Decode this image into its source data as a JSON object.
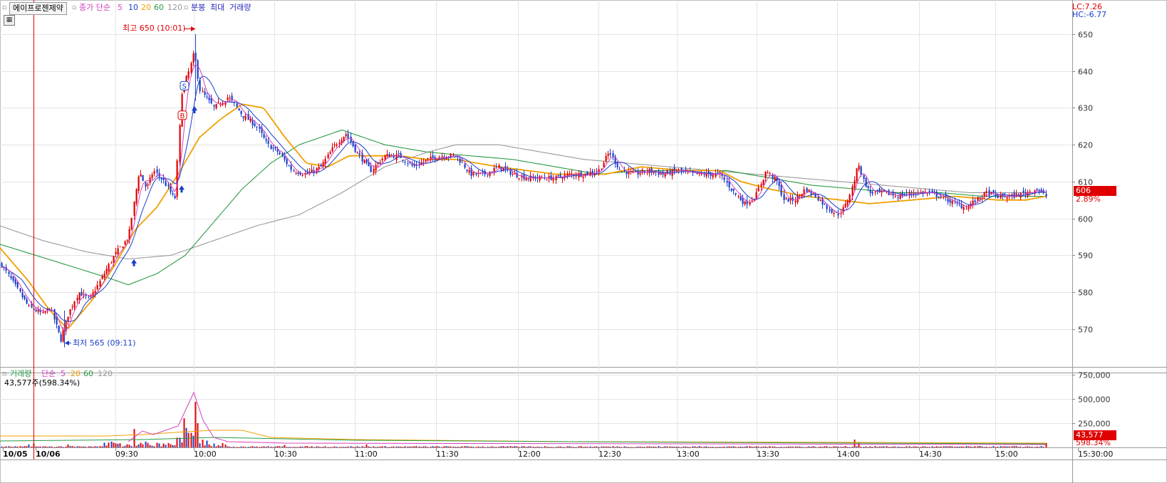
{
  "toolbar": {
    "stock_name": "에이프로젠제약",
    "ma_label": "종가 단순",
    "ma_periods": [
      "5",
      "10",
      "20",
      "60",
      "120"
    ],
    "ma_colors": [
      "#d43fbf",
      "#1a3fc8",
      "#f2a000",
      "#2a9a45",
      "#9a9a9a"
    ],
    "extra": [
      "분봉",
      "최대",
      "거래량"
    ]
  },
  "top_right": {
    "lc": "LC:7.26",
    "hc": "HC:-6.77"
  },
  "price_badge": {
    "price": "606",
    "pct": "2.89%"
  },
  "volume_panel": {
    "title": "거래량",
    "ma_label": "단순",
    "ma_periods": [
      "5",
      "20",
      "60",
      "120"
    ],
    "info": "43,577주(598.34%)",
    "badge_value": "43,577",
    "badge_pct": "598.34%"
  },
  "annotations": {
    "high": "최고 650 (10:01)",
    "low": "최저 565 (09:11)"
  },
  "chart_data": [
    {
      "type": "candlestick",
      "title": "",
      "y_ticks": [
        "650",
        "640",
        "630",
        "620",
        "610",
        "600",
        "590",
        "580",
        "570"
      ],
      "ylim": [
        560.5,
        652.5
      ],
      "x_ticks": [
        "10/05",
        "10/06",
        "09:30",
        "10:00",
        "10:30",
        "11:00",
        "11:30",
        "12:00",
        "12:30",
        "13:00",
        "13:30",
        "14:00",
        "14:30",
        "15:00",
        "15:30:00"
      ],
      "grid": true,
      "close_path": [
        [
          0,
          588
        ],
        [
          40,
          576
        ],
        [
          60,
          574
        ],
        [
          70,
          576
        ],
        [
          80,
          570
        ],
        [
          85,
          567
        ],
        [
          95,
          574
        ],
        [
          110,
          580
        ],
        [
          125,
          578
        ],
        [
          140,
          583
        ],
        [
          160,
          590
        ],
        [
          180,
          595
        ],
        [
          195,
          613
        ],
        [
          205,
          608
        ],
        [
          215,
          613
        ],
        [
          230,
          610
        ],
        [
          245,
          605
        ],
        [
          255,
          635
        ],
        [
          265,
          640
        ],
        [
          272,
          645
        ],
        [
          280,
          635
        ],
        [
          300,
          630
        ],
        [
          320,
          633
        ],
        [
          340,
          628
        ],
        [
          360,
          625
        ],
        [
          375,
          620
        ],
        [
          390,
          618
        ],
        [
          410,
          613
        ],
        [
          430,
          612
        ],
        [
          450,
          614
        ],
        [
          470,
          620
        ],
        [
          485,
          623
        ],
        [
          500,
          618
        ],
        [
          520,
          613
        ],
        [
          540,
          617
        ],
        [
          560,
          617
        ],
        [
          580,
          614
        ],
        [
          600,
          616
        ],
        [
          620,
          617
        ],
        [
          640,
          617
        ],
        [
          660,
          612
        ],
        [
          680,
          612
        ],
        [
          700,
          614
        ],
        [
          720,
          612
        ],
        [
          740,
          611
        ],
        [
          760,
          611
        ],
        [
          780,
          611
        ],
        [
          800,
          612
        ],
        [
          820,
          612
        ],
        [
          840,
          613
        ],
        [
          855,
          618
        ],
        [
          870,
          613
        ],
        [
          890,
          612
        ],
        [
          910,
          613
        ],
        [
          930,
          612
        ],
        [
          950,
          613
        ],
        [
          970,
          612
        ],
        [
          990,
          612
        ],
        [
          1010,
          612
        ],
        [
          1030,
          607
        ],
        [
          1045,
          604
        ],
        [
          1060,
          606
        ],
        [
          1075,
          613
        ],
        [
          1090,
          610
        ],
        [
          1100,
          605
        ],
        [
          1115,
          605
        ],
        [
          1130,
          608
        ],
        [
          1145,
          606
        ],
        [
          1160,
          603
        ],
        [
          1175,
          601
        ],
        [
          1185,
          603
        ],
        [
          1195,
          608
        ],
        [
          1205,
          615
        ],
        [
          1210,
          611
        ],
        [
          1220,
          607
        ],
        [
          1240,
          607
        ],
        [
          1260,
          606
        ],
        [
          1280,
          607
        ],
        [
          1300,
          607
        ],
        [
          1320,
          606
        ],
        [
          1340,
          604
        ],
        [
          1355,
          603
        ],
        [
          1370,
          605
        ],
        [
          1385,
          607
        ],
        [
          1400,
          606
        ],
        [
          1420,
          606
        ],
        [
          1440,
          607
        ],
        [
          1455,
          608
        ],
        [
          1468,
          606
        ]
      ],
      "moving_averages": {
        "ma20": [
          [
            0,
            592
          ],
          [
            40,
            583
          ],
          [
            70,
            575
          ],
          [
            95,
            570
          ],
          [
            130,
            578
          ],
          [
            160,
            587
          ],
          [
            190,
            597
          ],
          [
            220,
            603
          ],
          [
            250,
            612
          ],
          [
            280,
            622
          ],
          [
            310,
            627
          ],
          [
            340,
            631
          ],
          [
            370,
            630
          ],
          [
            400,
            622
          ],
          [
            430,
            615
          ],
          [
            460,
            614
          ],
          [
            490,
            617
          ],
          [
            520,
            617
          ],
          [
            560,
            617
          ],
          [
            600,
            616
          ],
          [
            640,
            616
          ],
          [
            700,
            614
          ],
          [
            780,
            612
          ],
          [
            850,
            612
          ],
          [
            900,
            614
          ],
          [
            960,
            613
          ],
          [
            1010,
            613
          ],
          [
            1040,
            610
          ],
          [
            1080,
            608
          ],
          [
            1130,
            606
          ],
          [
            1180,
            605
          ],
          [
            1220,
            604
          ],
          [
            1280,
            605
          ],
          [
            1340,
            606
          ],
          [
            1400,
            605
          ],
          [
            1440,
            605
          ],
          [
            1468,
            606
          ]
        ],
        "ma60": [
          [
            0,
            593
          ],
          [
            50,
            590
          ],
          [
            100,
            587
          ],
          [
            150,
            584
          ],
          [
            180,
            582
          ],
          [
            220,
            585
          ],
          [
            260,
            590
          ],
          [
            300,
            599
          ],
          [
            340,
            608
          ],
          [
            380,
            615
          ],
          [
            420,
            620
          ],
          [
            480,
            624
          ],
          [
            540,
            620
          ],
          [
            600,
            618
          ],
          [
            660,
            617
          ],
          [
            720,
            616
          ],
          [
            780,
            614
          ],
          [
            840,
            612
          ],
          [
            900,
            613
          ],
          [
            960,
            613
          ],
          [
            1020,
            613
          ],
          [
            1080,
            611
          ],
          [
            1140,
            609
          ],
          [
            1200,
            608
          ],
          [
            1260,
            607
          ],
          [
            1320,
            607
          ],
          [
            1380,
            606
          ],
          [
            1440,
            606
          ],
          [
            1468,
            606
          ]
        ],
        "ma120": [
          [
            0,
            598
          ],
          [
            60,
            594
          ],
          [
            120,
            591
          ],
          [
            180,
            589
          ],
          [
            240,
            590
          ],
          [
            300,
            594
          ],
          [
            360,
            598
          ],
          [
            420,
            601
          ],
          [
            480,
            607
          ],
          [
            540,
            614
          ],
          [
            600,
            618
          ],
          [
            640,
            620
          ],
          [
            700,
            620
          ],
          [
            760,
            618
          ],
          [
            820,
            616
          ],
          [
            880,
            615
          ],
          [
            940,
            614
          ],
          [
            1000,
            613
          ],
          [
            1060,
            612
          ],
          [
            1120,
            611
          ],
          [
            1180,
            610
          ],
          [
            1240,
            609
          ],
          [
            1300,
            608
          ],
          [
            1360,
            607
          ],
          [
            1420,
            607
          ],
          [
            1468,
            607
          ]
        ]
      },
      "signals": [
        {
          "type": "up-arrow",
          "x": 188,
          "price": 588
        },
        {
          "type": "up-arrow",
          "x": 255,
          "price": 608
        },
        {
          "type": "up-arrow",
          "x": 273,
          "price": 629.5
        },
        {
          "type": "B",
          "x": 256,
          "price": 628
        },
        {
          "type": "S",
          "x": 259,
          "price": 636
        }
      ]
    },
    {
      "type": "bar",
      "title": "",
      "y_ticks": [
        "750,000",
        "500,000",
        "250,000"
      ],
      "ylim": [
        0,
        750000
      ],
      "spikes": [
        [
          40,
          30000
        ],
        [
          48,
          40000
        ],
        [
          95,
          30000
        ],
        [
          155,
          60000
        ],
        [
          188,
          190000
        ],
        [
          205,
          60000
        ],
        [
          250,
          100000
        ],
        [
          258,
          300000
        ],
        [
          262,
          200000
        ],
        [
          266,
          150000
        ],
        [
          270,
          120000
        ],
        [
          274,
          470000
        ],
        [
          278,
          250000
        ],
        [
          283,
          80000
        ],
        [
          290,
          70000
        ],
        [
          300,
          40000
        ],
        [
          400,
          25000
        ],
        [
          515,
          30000
        ],
        [
          1200,
          80000
        ],
        [
          1205,
          50000
        ],
        [
          1468,
          45000
        ]
      ]
    }
  ]
}
